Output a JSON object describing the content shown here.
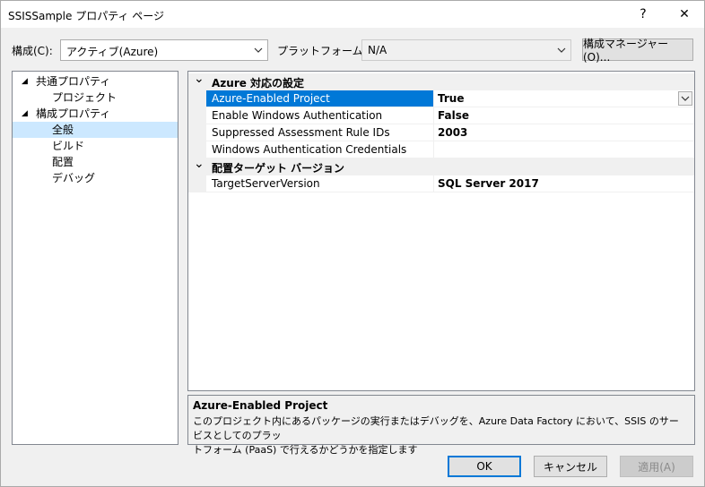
{
  "window": {
    "title": "SSISSample プロパティ ページ",
    "help_glyph": "?",
    "close_glyph": "✕"
  },
  "config": {
    "label": "構成(C):",
    "value": "アクティブ(Azure)",
    "platform_label": "プラットフォーム(P):",
    "platform_value": "N/A",
    "manager_button": "構成マネージャー(O)..."
  },
  "tree": [
    {
      "label": "共通プロパティ",
      "level": 0,
      "expanded": true,
      "selected": false
    },
    {
      "label": "プロジェクト",
      "level": 1,
      "selected": false
    },
    {
      "label": "構成プロパティ",
      "level": 0,
      "expanded": true,
      "selected": false
    },
    {
      "label": "全般",
      "level": 1,
      "selected": true
    },
    {
      "label": "ビルド",
      "level": 1,
      "selected": false
    },
    {
      "label": "配置",
      "level": 1,
      "selected": false
    },
    {
      "label": "デバッグ",
      "level": 1,
      "selected": false
    }
  ],
  "grid": {
    "categories": [
      {
        "label": "Azure 対応の設定",
        "properties": [
          {
            "name": "Azure-Enabled Project",
            "value": "True",
            "selected": true
          },
          {
            "name": "Enable Windows Authentication",
            "value": "False"
          },
          {
            "name": "Suppressed Assessment Rule IDs",
            "value": "2003"
          },
          {
            "name": "Windows Authentication Credentials",
            "value": ""
          }
        ]
      },
      {
        "label": "配置ターゲット バージョン",
        "properties": [
          {
            "name": "TargetServerVersion",
            "value": "SQL Server 2017"
          }
        ]
      }
    ]
  },
  "description": {
    "title": "Azure-Enabled Project",
    "line1": "このプロジェクト内にあるパッケージの実行またはデバッグを、Azure Data Factory において、SSIS のサービスとしてのプラッ",
    "line2": "トフォーム (PaaS) で行えるかどうかを指定します"
  },
  "buttons": {
    "ok": "OK",
    "cancel": "キャンセル",
    "apply": "適用(A)"
  },
  "colors": {
    "selection": "#0078d7",
    "tree_selection": "#cce8ff"
  }
}
